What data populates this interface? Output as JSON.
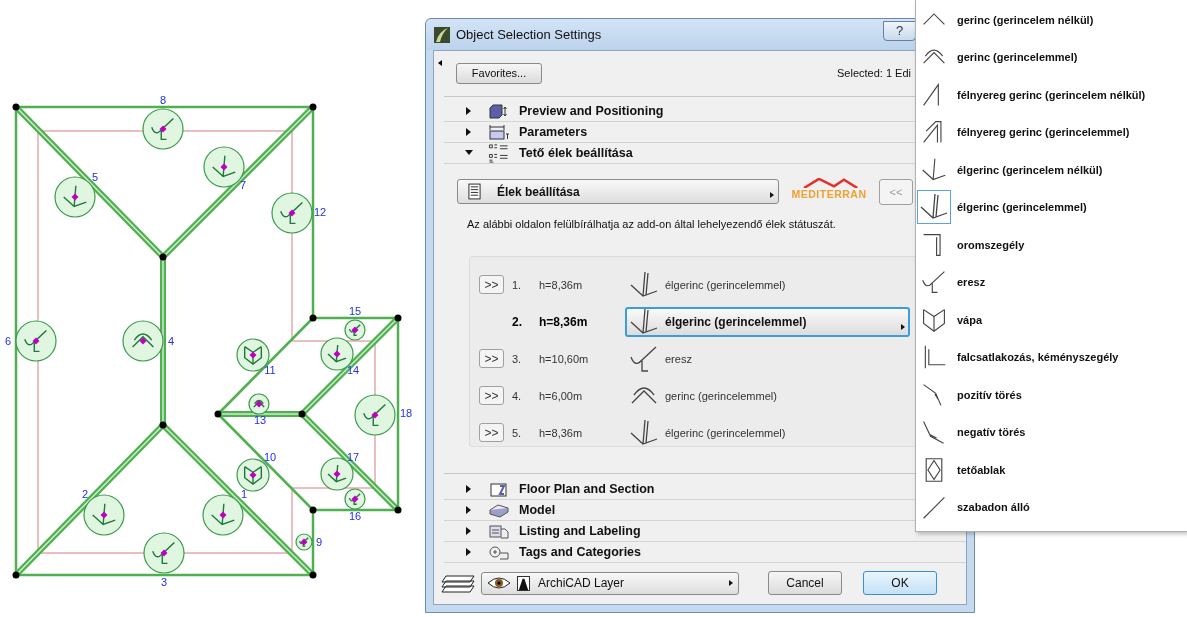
{
  "roof_plan": {
    "edges": [
      {
        "number": "8",
        "kind": "eaves"
      },
      {
        "number": "5",
        "kind": "hip"
      },
      {
        "number": "7",
        "kind": "hip"
      },
      {
        "number": "12",
        "kind": "eaves"
      },
      {
        "number": "15",
        "kind": "eaves"
      },
      {
        "number": "6",
        "kind": "eaves"
      },
      {
        "number": "4",
        "kind": "ridge-cap"
      },
      {
        "number": "11",
        "kind": "valley"
      },
      {
        "number": "14",
        "kind": "hip"
      },
      {
        "number": "18",
        "kind": "eaves"
      },
      {
        "number": "13",
        "kind": "ridge-cap"
      },
      {
        "number": "10",
        "kind": "valley"
      },
      {
        "number": "17",
        "kind": "hip"
      },
      {
        "number": "2",
        "kind": "hip"
      },
      {
        "number": "1",
        "kind": "hip"
      },
      {
        "number": "16",
        "kind": "eaves"
      },
      {
        "number": "9",
        "kind": "eaves"
      },
      {
        "number": "3",
        "kind": "eaves"
      }
    ]
  },
  "window": {
    "title": "Object Selection Settings",
    "help_button": "?"
  },
  "favorites_button": "Favorites...",
  "selected_info": "Selected: 1 Edi",
  "sections": [
    {
      "title": "Preview and Positioning",
      "expanded": false
    },
    {
      "title": "Parameters",
      "expanded": false
    },
    {
      "title": "Tető élek beállítása",
      "expanded": true
    },
    {
      "title": "Floor Plan and Section",
      "expanded": false
    },
    {
      "title": "Model",
      "expanded": false
    },
    {
      "title": "Listing and Labeling",
      "expanded": false
    },
    {
      "title": "Tags and Categories",
      "expanded": false
    }
  ],
  "edge_settings": {
    "page_dropdown": "Élek beállítása",
    "logo": "MEDITERRAN",
    "prev_button": "<<",
    "description": "Az alábbi oldalon felülbírálhatja az add-on által lehelyezendő élek státuszát.",
    "rows": [
      {
        "jump_button": ">>",
        "number": "1.",
        "height": "h=8,36m",
        "type": "élgerinc (gerincelemmel)",
        "kind": "hip-cap",
        "selected": false
      },
      {
        "number": "2.",
        "height": "h=8,36m",
        "type": "élgerinc (gerincelemmel)",
        "kind": "hip-cap",
        "selected": true
      },
      {
        "jump_button": ">>",
        "number": "3.",
        "height": "h=10,60m",
        "type": "eresz",
        "kind": "eaves",
        "selected": false
      },
      {
        "jump_button": ">>",
        "number": "4.",
        "height": "h=6,00m",
        "type": "gerinc (gerincelemmel)",
        "kind": "ridge-cap",
        "selected": false
      },
      {
        "jump_button": ">>",
        "number": "5.",
        "height": "h=8,36m",
        "type": "élgerinc (gerincelemmel)",
        "kind": "hip-cap",
        "selected": false
      }
    ]
  },
  "layer": "ArchiCAD Layer",
  "buttons": {
    "cancel": "Cancel",
    "ok": "OK"
  },
  "type_menu": [
    {
      "label": "gerinc (gerincelem nélkül)",
      "kind": "ridge",
      "selected": false
    },
    {
      "label": "gerinc (gerincelemmel)",
      "kind": "ridge-cap",
      "selected": false
    },
    {
      "label": "félnyereg gerinc (gerincelem nélkül)",
      "kind": "half-ridge",
      "selected": false
    },
    {
      "label": "félnyereg gerinc (gerincelemmel)",
      "kind": "half-ridge-cap",
      "selected": false
    },
    {
      "label": "élgerinc (gerincelem nélkül)",
      "kind": "hip",
      "selected": false
    },
    {
      "label": "élgerinc (gerincelemmel)",
      "kind": "hip-cap",
      "selected": true
    },
    {
      "label": "oromszegély",
      "kind": "verge",
      "selected": false
    },
    {
      "label": "eresz",
      "kind": "eaves",
      "selected": false
    },
    {
      "label": "vápa",
      "kind": "valley",
      "selected": false
    },
    {
      "label": "falcsatlakozás, kéményszegély",
      "kind": "wall-flashing",
      "selected": false
    },
    {
      "label": "pozitív törés",
      "kind": "convex-break",
      "selected": false
    },
    {
      "label": "negatív törés",
      "kind": "concave-break",
      "selected": false
    },
    {
      "label": "tetőablak",
      "kind": "roof-window",
      "selected": false
    },
    {
      "label": "szabadon álló",
      "kind": "free-edge",
      "selected": false
    }
  ]
}
